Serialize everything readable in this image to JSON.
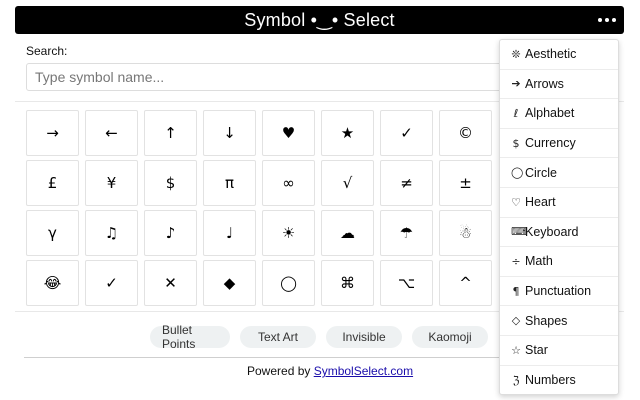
{
  "header": {
    "title": "Symbol •‿• Select"
  },
  "search": {
    "label": "Search:",
    "placeholder": "Type symbol name...",
    "value": ""
  },
  "grid": {
    "symbols": [
      "→",
      "←",
      "↑",
      "↓",
      "♥",
      "★",
      "✓",
      "©",
      "£",
      "¥",
      "$",
      "π",
      "∞",
      "√",
      "≠",
      "±",
      "γ",
      "♫",
      "♪",
      "♩",
      "☀",
      "☁",
      "☂",
      "☃",
      "😂",
      "✓",
      "✕",
      "◆",
      "◯",
      "⌘",
      "⌥",
      "^"
    ]
  },
  "chips": [
    "Bullet Points",
    "Text Art",
    "Invisible",
    "Kaomoji"
  ],
  "footer": {
    "prefix": "Powered by ",
    "link": "SymbolSelect.com"
  },
  "menu": {
    "items": [
      {
        "icon": "❊",
        "label": "Aesthetic"
      },
      {
        "icon": "➔",
        "label": "Arrows"
      },
      {
        "icon": "ℓ",
        "label": "Alphabet"
      },
      {
        "icon": "$",
        "label": "Currency"
      },
      {
        "icon": "◯",
        "label": "Circle"
      },
      {
        "icon": "♡",
        "label": "Heart"
      },
      {
        "icon": "⌨",
        "label": "Keyboard"
      },
      {
        "icon": "÷",
        "label": "Math"
      },
      {
        "icon": "¶",
        "label": "Punctuation"
      },
      {
        "icon": "◇",
        "label": "Shapes"
      },
      {
        "icon": "☆",
        "label": "Star"
      },
      {
        "icon": "ℨ",
        "label": "Numbers"
      }
    ]
  }
}
